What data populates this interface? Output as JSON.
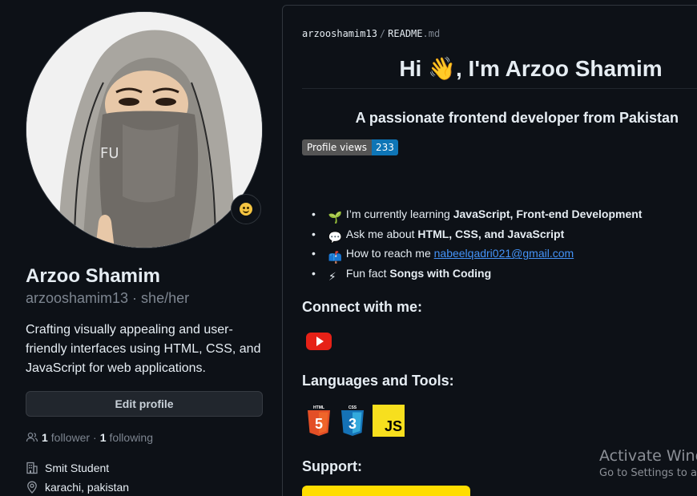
{
  "profile": {
    "name": "Arzoo Shamim",
    "username": "arzooshamim13",
    "pronouns": "she/her",
    "username_line": "arzooshamim13 · she/her",
    "bio": "Crafting visually appealing and user-friendly interfaces using HTML, CSS, and JavaScript for web applications.",
    "edit_label": "Edit profile",
    "followers_count": "1",
    "followers_label": "follower",
    "following_count": "1",
    "following_label": "following",
    "follow_sep": "·",
    "company": "Smit Student",
    "location": "karachi, pakistan",
    "avatar_mark": "FU"
  },
  "readme": {
    "path_owner": "arzooshamim13",
    "path_sep": "/",
    "path_file": "README",
    "path_ext": ".md",
    "heading_before": "Hi",
    "heading_emoji": "👋",
    "heading_after": ", I'm Arzoo Shamim",
    "subheading": "A passionate frontend developer from Pakistan",
    "badge_label": "Profile views",
    "badge_value": "233",
    "bullets": [
      {
        "icon": "seedling-icon",
        "emoji": "🌱",
        "text": "I’m currently learning ",
        "bold": "JavaScript, Front-end Development"
      },
      {
        "icon": "speech-bubble-icon",
        "emoji": "💬",
        "text": "Ask me about ",
        "bold": "HTML, CSS, and JavaScript"
      },
      {
        "icon": "mailbox-icon",
        "emoji": "📫",
        "text": "How to reach me ",
        "link": "nabeelqadri021@gmail.com"
      },
      {
        "icon": "lightning-icon",
        "emoji": "⚡",
        "text": "Fun fact ",
        "bold": "Songs with Coding"
      }
    ],
    "connect_heading": "Connect with me:",
    "languages_heading": "Languages and Tools:",
    "support_heading": "Support:",
    "tools": [
      "html5-icon",
      "css3-icon",
      "javascript-icon"
    ],
    "js_text": "JS",
    "html_number": "5",
    "css_number": "3"
  },
  "watermark": {
    "line1": "Activate Wind",
    "line2": "Go to Settings to a"
  },
  "colors": {
    "background": "#0d1117",
    "link": "#4493f8",
    "badge_value_bg": "#0e75b6",
    "youtube": "#e62117",
    "js_yellow": "#f7df1e",
    "support_yellow": "#ffdd00"
  }
}
